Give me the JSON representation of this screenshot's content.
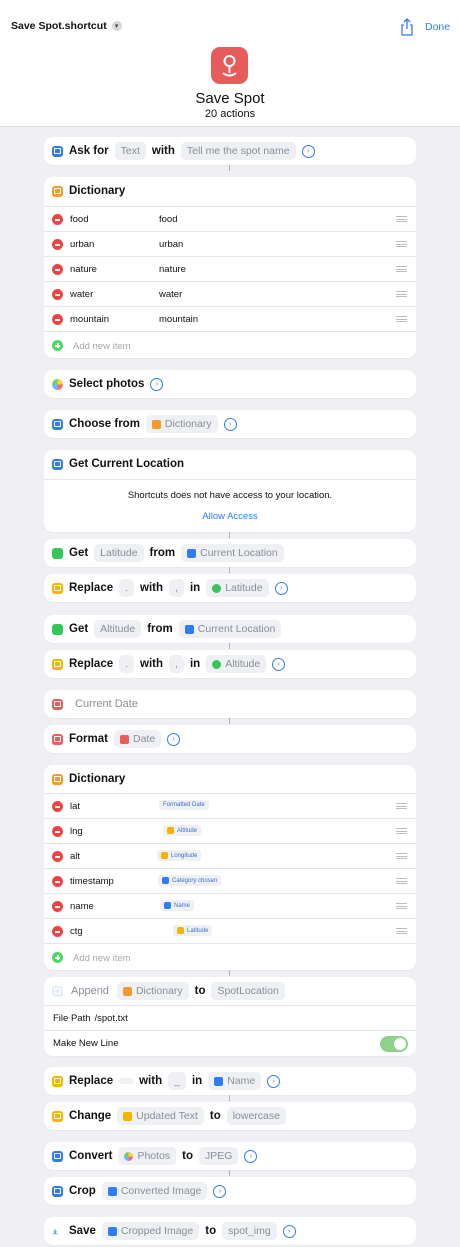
{
  "nav": {
    "title": "Save Spot.shortcut",
    "done_label": "Done"
  },
  "shortcut": {
    "name": "Save Spot",
    "count_label": "20 actions"
  },
  "ask": {
    "verb": "Ask for",
    "type": "Text",
    "with": "with",
    "prompt": "Tell me the spot name"
  },
  "dict1": {
    "title": "Dictionary",
    "rows": [
      {
        "key": "food",
        "value": "food"
      },
      {
        "key": "urban",
        "value": "urban"
      },
      {
        "key": "nature",
        "value": "nature"
      },
      {
        "key": "water",
        "value": "water"
      },
      {
        "key": "mountain",
        "value": "mountain"
      }
    ],
    "add_label": "Add new item"
  },
  "select_photos": {
    "label": "Select photos"
  },
  "choose": {
    "verb": "Choose from",
    "source": "Dictionary"
  },
  "location": {
    "title": "Get Current Location",
    "message": "Shortcuts does not have access to your location.",
    "allow_label": "Allow Access"
  },
  "get_lat": {
    "verb": "Get",
    "what": "Latitude",
    "from": "from",
    "source": "Current Location"
  },
  "replace_lat": {
    "verb": "Replace",
    "find": ".",
    "with": "with",
    "replace": ",",
    "in": "in",
    "target": "Latitude"
  },
  "get_alt": {
    "verb": "Get",
    "what": "Altitude",
    "from": "from",
    "source": "Current Location"
  },
  "replace_alt": {
    "verb": "Replace",
    "find": ".",
    "with": "with",
    "replace": ",",
    "in": "in",
    "target": "Altitude"
  },
  "current_date": {
    "label": "Current Date"
  },
  "format": {
    "verb": "Format",
    "target": "Date"
  },
  "dict2": {
    "title": "Dictionary",
    "rows": [
      {
        "key": "lat",
        "value": "Formatted Date"
      },
      {
        "key": "lng",
        "value": "Altitude"
      },
      {
        "key": "alt",
        "value": "Longitude"
      },
      {
        "key": "timestamp",
        "value": "Category chosen"
      },
      {
        "key": "name",
        "value": "Name"
      },
      {
        "key": "ctg",
        "value": "Latitude"
      }
    ],
    "add_label": "Add new item"
  },
  "append": {
    "verb": "Append",
    "source": "Dictionary",
    "to": "to",
    "target": "SpotLocation",
    "file_path_label": "File Path",
    "file_path_value": "/spot.txt",
    "new_line_label": "Make New Line",
    "new_line_on": true
  },
  "replace_name": {
    "verb": "Replace",
    "with": "with",
    "replace": "_",
    "in": "in",
    "target": "Name"
  },
  "change": {
    "verb": "Change",
    "source": "Updated Text",
    "to": "to",
    "target": "lowercase"
  },
  "convert": {
    "verb": "Convert",
    "source": "Photos",
    "to": "to",
    "target": "JPEG"
  },
  "crop": {
    "verb": "Crop",
    "target": "Converted Image"
  },
  "save": {
    "verb": "Save",
    "source": "Cropped Image",
    "to": "to",
    "target": "spot_img"
  }
}
